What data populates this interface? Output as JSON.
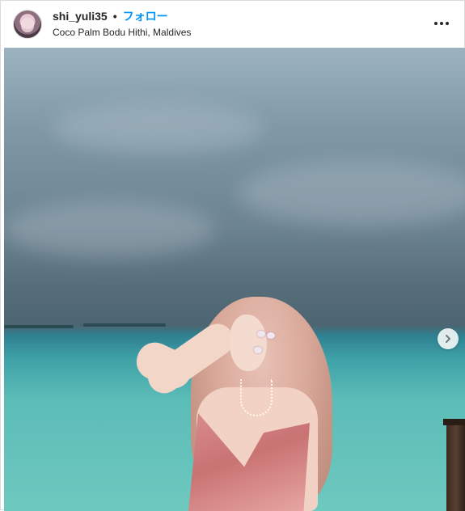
{
  "post": {
    "username": "shi_yuli35",
    "separator": "•",
    "follow_label": "フォロー",
    "location": "Coco Palm Bodu Hithi, Maldives"
  },
  "icons": {
    "more": "more-options-icon",
    "next": "chevron-right-icon"
  },
  "colors": {
    "follow": "#0095f6",
    "text": "#262626",
    "border": "#dbdbdb"
  }
}
